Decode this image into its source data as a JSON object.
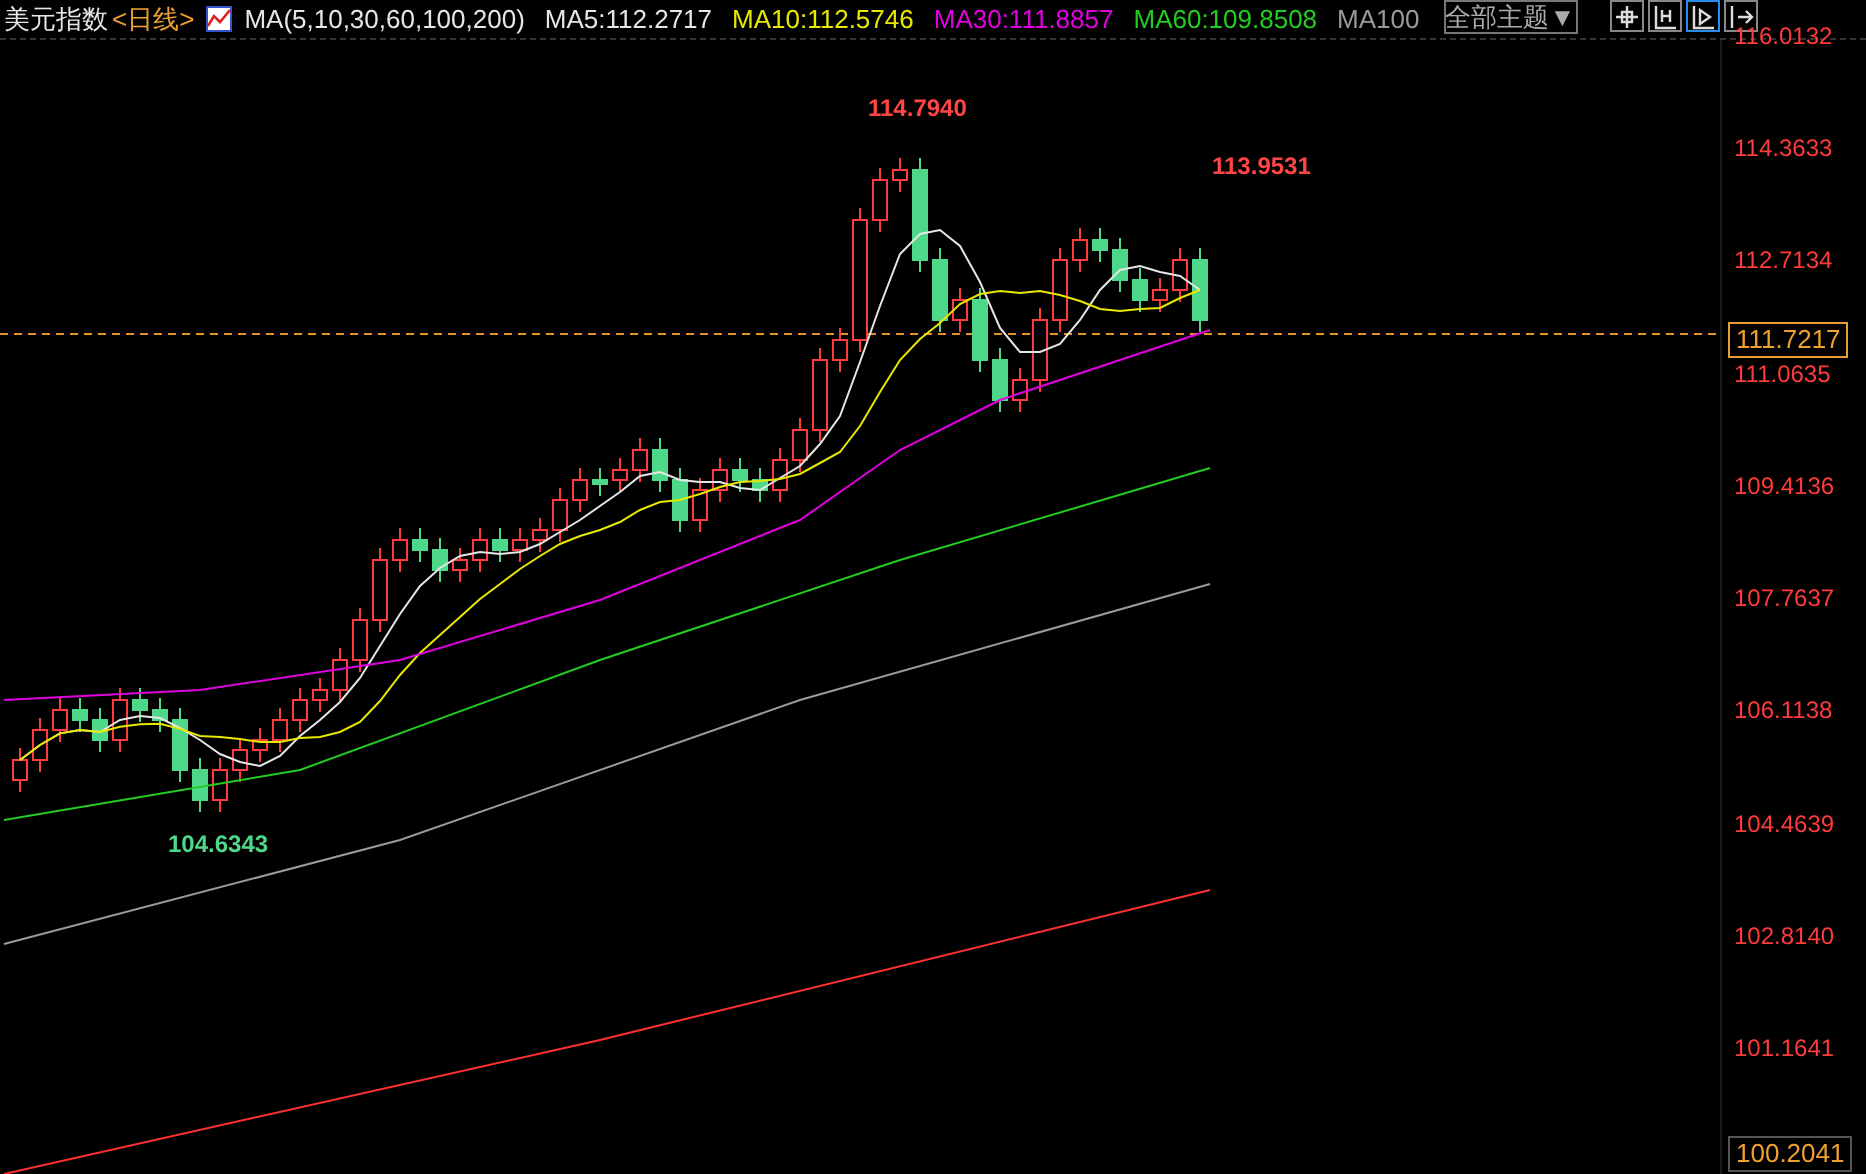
{
  "header": {
    "title": "美元指数",
    "period": "<日线>",
    "indicator": "MA(5,10,30,60,100,200)",
    "ma_values": [
      {
        "text": "MA5:112.2717",
        "color": "#e6e6e6"
      },
      {
        "text": "MA10:112.5746",
        "color": "#e8e800"
      },
      {
        "text": "MA30:111.8857",
        "color": "#e000e0"
      },
      {
        "text": "MA60:109.8508",
        "color": "#22cc22"
      },
      {
        "text": "MA100",
        "color": "#9a9a9a"
      }
    ],
    "theme_button": "全部主题▼",
    "toolbar": [
      {
        "kind": "crosshair",
        "selected": false
      },
      {
        "kind": "range",
        "selected": false
      },
      {
        "kind": "cursor",
        "selected": true
      },
      {
        "kind": "exit",
        "selected": false
      }
    ]
  },
  "chart": {
    "price_labels": [
      "116.0132",
      "114.3633",
      "112.7134",
      "111.0635",
      "109.4136",
      "107.7637",
      "106.1138",
      "104.4639",
      "102.8140",
      "101.1641"
    ],
    "current_price": "111.7217",
    "bottom_price": "100.2041",
    "annotations": [
      {
        "text": "114.7940",
        "kind": "high"
      },
      {
        "text": "113.9531",
        "kind": "high"
      },
      {
        "text": "104.6343",
        "kind": "low"
      }
    ]
  }
}
